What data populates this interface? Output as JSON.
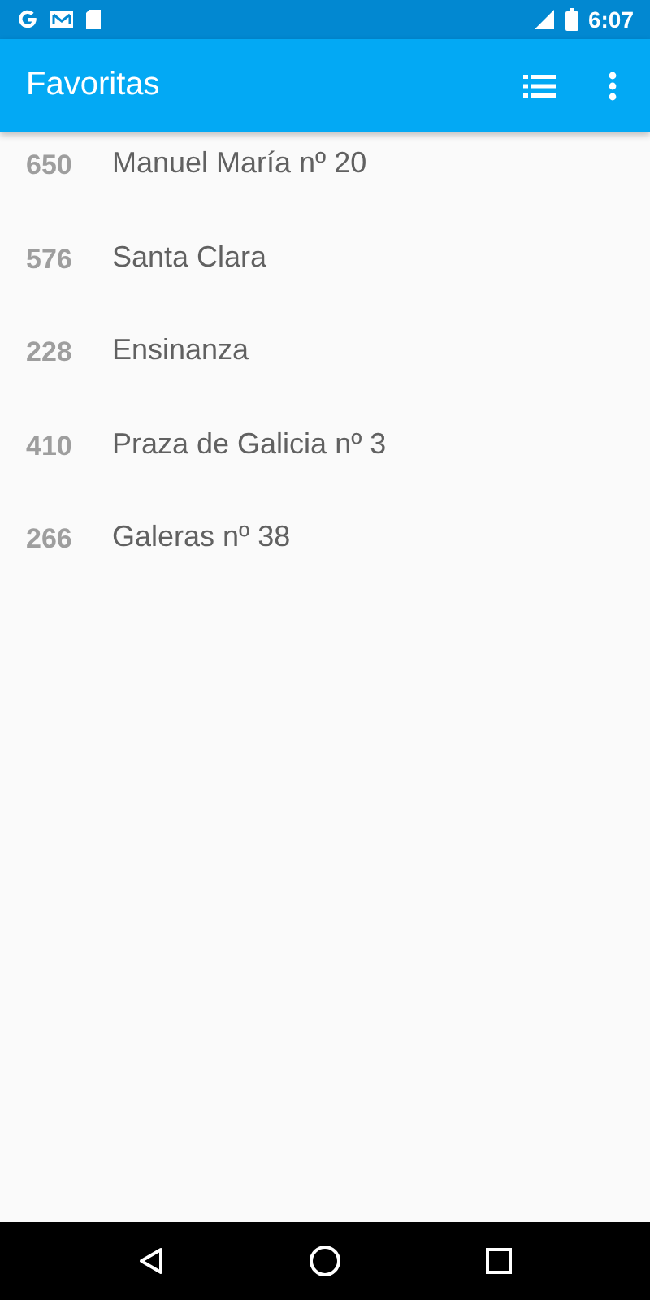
{
  "status_bar": {
    "time": "6:07"
  },
  "app_bar": {
    "title": "Favoritas"
  },
  "favorites": [
    {
      "number": "650",
      "name": "Manuel María nº 20"
    },
    {
      "number": "576",
      "name": "Santa Clara"
    },
    {
      "number": "228",
      "name": "Ensinanza"
    },
    {
      "number": "410",
      "name": "Praza de Galicia nº 3"
    },
    {
      "number": "266",
      "name": "Galeras nº 38"
    }
  ]
}
